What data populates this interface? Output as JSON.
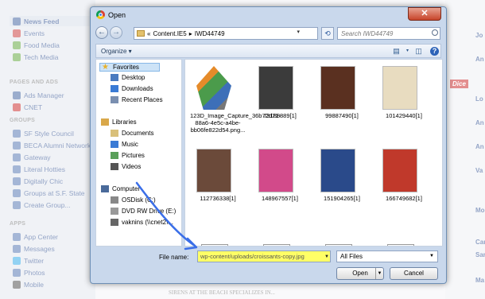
{
  "facebook": {
    "nav_top": [
      {
        "label": "News Feed",
        "color": "#4a6aa5",
        "active": true
      },
      {
        "label": "Events",
        "color": "#c44"
      },
      {
        "label": "Food Media",
        "color": "#6a4"
      },
      {
        "label": "Tech Media",
        "color": "#6a4"
      }
    ],
    "pages_header": "PAGES AND ADS",
    "pages": [
      {
        "label": "Ads Manager",
        "color": "#4a6aa5"
      },
      {
        "label": "CNET",
        "color": "#c33"
      }
    ],
    "groups_header": "GROUPS",
    "groups": [
      {
        "label": "SF Style Council",
        "color": "#5a7bb5"
      },
      {
        "label": "BECA Alumni Network",
        "color": "#5a7bb5"
      },
      {
        "label": "Gateway",
        "color": "#5a7bb5"
      },
      {
        "label": "Literal Hotties",
        "color": "#5a7bb5"
      },
      {
        "label": "Digitally Chic",
        "color": "#5a7bb5"
      },
      {
        "label": "Groups at S.F. State",
        "color": "#5a7bb5"
      },
      {
        "label": "Create Group...",
        "color": "#5a7bb5"
      }
    ],
    "apps_header": "APPS",
    "apps": [
      {
        "label": "App Center",
        "color": "#5a7bb5"
      },
      {
        "label": "Messages",
        "color": "#5a7bb5"
      },
      {
        "label": "Twitter",
        "color": "#3aaeea"
      },
      {
        "label": "Photos",
        "color": "#5a7bb5"
      },
      {
        "label": "Mobile",
        "color": "#555"
      }
    ],
    "right_snippets": [
      "Jo",
      "An",
      "Dice",
      "Lo",
      "An",
      "An",
      "Va",
      "Monica",
      "Carlton",
      "Sarah",
      "Ma"
    ],
    "bottom_text": "SIRENS AT THE BEACH SPECIALIZES IN..."
  },
  "dialog": {
    "title": "Open",
    "close_label": "✕",
    "breadcrumb": [
      "«",
      "Content.IE5",
      "▸",
      "IWD44749"
    ],
    "search_placeholder": "Search IWD44749",
    "organize_label": "Organize ▾",
    "nav_items": [
      {
        "label": "Favorites",
        "icon": "star-icon",
        "color": "#e8b12a",
        "selected": true
      },
      {
        "label": "Desktop",
        "icon": "desktop-icon",
        "color": "#4a7bc0"
      },
      {
        "label": "Downloads",
        "icon": "downloads-icon",
        "color": "#3a7bd5"
      },
      {
        "label": "Recent Places",
        "icon": "recent-places-icon",
        "color": "#7a8fb0"
      },
      {
        "label": "Libraries",
        "icon": "libraries-icon",
        "color": "#d9a84a"
      },
      {
        "label": "Documents",
        "icon": "documents-icon",
        "color": "#d9c07a"
      },
      {
        "label": "Music",
        "icon": "music-icon",
        "color": "#3a7bd5"
      },
      {
        "label": "Pictures",
        "icon": "pictures-icon",
        "color": "#5aa05a"
      },
      {
        "label": "Videos",
        "icon": "videos-icon",
        "color": "#555"
      },
      {
        "label": "Computer",
        "icon": "computer-icon",
        "color": "#4a6a9a"
      },
      {
        "label": "OSDisk (C:)",
        "icon": "disk-icon",
        "color": "#888"
      },
      {
        "label": "DVD RW Drive (E:)",
        "icon": "dvd-icon",
        "color": "#999"
      },
      {
        "label": "vaknins (\\\\cnet2\\...",
        "icon": "network-drive-icon",
        "color": "#666"
      }
    ],
    "files": [
      {
        "name": "123D_Image_Capture_36b72d71-88a6-4e5c-a4be-bb06fe822d54.png...",
        "color": "#d68a3a"
      },
      {
        "name": "73188889[1]",
        "color": "#3b3b3b"
      },
      {
        "name": "99887490[1]",
        "color": "#5a3020"
      },
      {
        "name": "101429440[1]",
        "color": "#e8dcc0"
      },
      {
        "name": "112736338[1]",
        "color": "#6b4a3a"
      },
      {
        "name": "148967557[1]",
        "color": "#d24a8a"
      },
      {
        "name": "151904265[1]",
        "color": "#2a4a8a"
      },
      {
        "name": "166749682[1]",
        "color": "#c0392b"
      },
      {
        "name": "",
        "color": "#eee"
      },
      {
        "name": "",
        "color": "#eee"
      },
      {
        "name": "",
        "color": "#eee"
      },
      {
        "name": "",
        "color": "#eee"
      }
    ],
    "file_name_label": "File name:",
    "file_name_value": "wp-content/uploads/croissants-copy.jpg",
    "file_type": "All Files",
    "open_label": "Open",
    "cancel_label": "Cancel"
  },
  "colors": {
    "highlight": "#ffff66",
    "arrow": "#3a6ee8"
  }
}
